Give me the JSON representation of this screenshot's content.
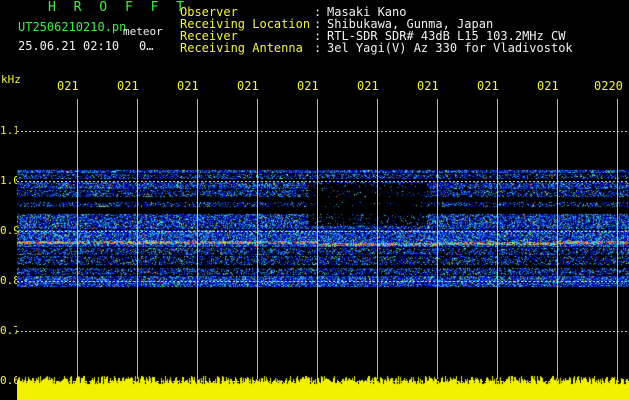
{
  "app": {
    "brand": "H R O F F T"
  },
  "file": {
    "name": "UT2506210210.pn",
    "tag": "meteor",
    "datetime": "25.06.21 02:10",
    "count": "0…"
  },
  "info": [
    {
      "label": "Observer",
      "value": "Masaki Kano"
    },
    {
      "label": "Receiving Location",
      "value": "Shibukawa, Gunma, Japan"
    },
    {
      "label": "Receiver",
      "value": "RTL-SDR SDR# 43dB L15 103.2MHz CW"
    },
    {
      "label": "Receiving Antenna",
      "value": "3el Yagi(V) Az 330 for Vladivostok"
    }
  ],
  "separator": ":",
  "axis": {
    "unit": "kHz",
    "x_ticks": [
      "021",
      "021",
      "021",
      "021",
      "021",
      "021",
      "021",
      "021",
      "021",
      "0220"
    ],
    "y_ticks": [
      "1.1",
      "1.0",
      "0.9",
      "0.8",
      "0.7",
      "0.6"
    ]
  },
  "colors": {
    "brand": "#3cf23c",
    "label": "#f4f43a",
    "text": "#f2f2f2",
    "background": "#000000",
    "amplitude": "#f2f200"
  }
}
